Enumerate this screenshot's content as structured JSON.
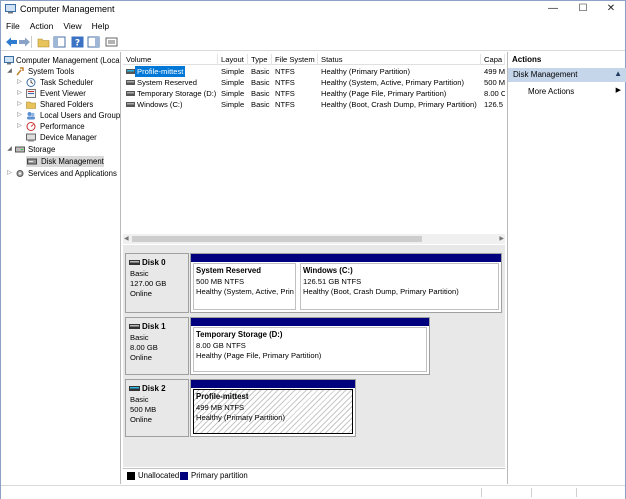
{
  "window": {
    "title": "Computer Management"
  },
  "menu": [
    "File",
    "Action",
    "View",
    "Help"
  ],
  "tree": {
    "root": "Computer Management (Local",
    "items": [
      {
        "label": "System Tools",
        "icon": "tools-icon"
      },
      {
        "label": "Task Scheduler",
        "icon": "clock-icon"
      },
      {
        "label": "Event Viewer",
        "icon": "event-viewer-icon"
      },
      {
        "label": "Shared Folders",
        "icon": "folder-icon"
      },
      {
        "label": "Local Users and Groups",
        "icon": "users-icon"
      },
      {
        "label": "Performance",
        "icon": "performance-icon"
      },
      {
        "label": "Device Manager",
        "icon": "device-manager-icon"
      },
      {
        "label": "Storage",
        "icon": "storage-icon"
      },
      {
        "label": "Disk Management",
        "icon": "disk-management-icon"
      },
      {
        "label": "Services and Applications",
        "icon": "services-icon"
      }
    ]
  },
  "volumes": {
    "columns": [
      "Volume",
      "Layout",
      "Type",
      "File System",
      "Status",
      "Capa"
    ],
    "rows": [
      {
        "volume": "Profile-mittest",
        "layout": "Simple",
        "type": "Basic",
        "fs": "NTFS",
        "status": "Healthy (Primary Partition)",
        "capacity": "499 M"
      },
      {
        "volume": "System Reserved",
        "layout": "Simple",
        "type": "Basic",
        "fs": "NTFS",
        "status": "Healthy (System, Active, Primary Partition)",
        "capacity": "500 M"
      },
      {
        "volume": "Temporary Storage (D:)",
        "layout": "Simple",
        "type": "Basic",
        "fs": "NTFS",
        "status": "Healthy (Page File, Primary Partition)",
        "capacity": "8.00 C"
      },
      {
        "volume": "Windows (C:)",
        "layout": "Simple",
        "type": "Basic",
        "fs": "NTFS",
        "status": "Healthy (Boot, Crash Dump, Primary Partition)",
        "capacity": "126.5"
      }
    ]
  },
  "disks": [
    {
      "name": "Disk 0",
      "type": "Basic",
      "size": "127.00 GB",
      "state": "Online",
      "partitions": [
        {
          "title": "System Reserved",
          "size": "500 MB NTFS",
          "status": "Healthy (System, Active, Prin"
        },
        {
          "title": "Windows  (C:)",
          "size": "126.51 GB NTFS",
          "status": "Healthy (Boot, Crash Dump, Primary Partition)"
        }
      ]
    },
    {
      "name": "Disk 1",
      "type": "Basic",
      "size": "8.00 GB",
      "state": "Online",
      "partitions": [
        {
          "title": "Temporary Storage  (D:)",
          "size": "8.00 GB NTFS",
          "status": "Healthy (Page File, Primary Partition)"
        }
      ]
    },
    {
      "name": "Disk 2",
      "type": "Basic",
      "size": "500 MB",
      "state": "Online",
      "partitions": [
        {
          "title": "Profile-mittest",
          "size": "499 MB NTFS",
          "status": "Healthy (Primary Partition)"
        }
      ]
    }
  ],
  "legend": [
    {
      "label": "Unallocated",
      "color": "#000000"
    },
    {
      "label": "Primary partition",
      "color": "#00007f"
    }
  ],
  "actions": {
    "title": "Actions",
    "group": "Disk Management",
    "items": [
      "More Actions"
    ]
  }
}
